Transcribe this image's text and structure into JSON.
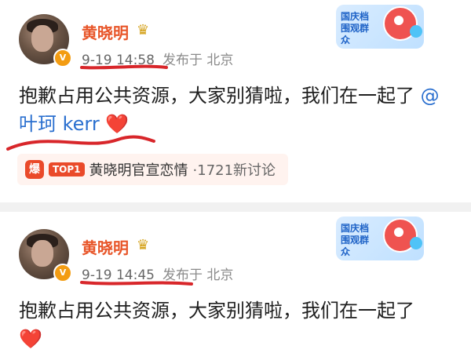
{
  "posts": [
    {
      "author": "黄晓明",
      "vip_badge": "V",
      "time": "9-19 14:58",
      "source": "发布于 北京",
      "text": "抱歉占用公共资源，大家别猜啦，我们在一起了",
      "mention": "@叶珂 kerr",
      "emoji": "❤️",
      "hot_topic": {
        "tag": "爆",
        "rank": "TOP1",
        "title": "黄晓明官宣恋情",
        "count": "·1721新讨论"
      },
      "banner": "国庆档围观群众"
    },
    {
      "author": "黄晓明",
      "vip_badge": "V",
      "time": "9-19 14:45",
      "source": "发布于 北京",
      "text": "抱歉占用公共资源，大家别猜啦，我们在一起了",
      "emoji": "❤️",
      "banner": "国庆档围观群众"
    }
  ],
  "colors": {
    "name": "#e8562a",
    "mention": "#2a6fcf",
    "underline": "#d8262a",
    "hot_tag": "#ea4a2a"
  },
  "icons": [
    "crown-icon",
    "vip-badge-icon",
    "heart-icon",
    "hot-badge-icon"
  ]
}
